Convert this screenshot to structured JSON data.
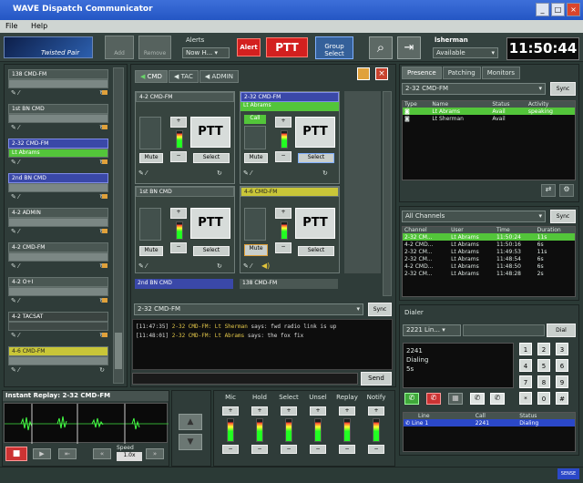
{
  "window": {
    "title": "WAVE Dispatch Communicator",
    "menu": [
      "File",
      "Help"
    ]
  },
  "toolbar": {
    "logo": "Twisted Pair",
    "add": "Add",
    "remove": "Remove",
    "alerts_label": "Alerts",
    "alerts_value": "Now H...",
    "alert": "Alert",
    "ptt": "PTT",
    "group_select": "Group Select",
    "user": "lsherman",
    "status": "Available",
    "clock": "11:50:44"
  },
  "left_channels": [
    {
      "name": "138 CMD-FM"
    },
    {
      "name": "1st BN CMD"
    },
    {
      "name": "2-32 CMD-FM",
      "talker": "Lt Abrams"
    },
    {
      "name": "2nd BN CMD"
    },
    {
      "name": "4-2 ADMIN"
    },
    {
      "name": "4-2 CMD-FM"
    },
    {
      "name": "4-2 O+I"
    },
    {
      "name": "4-2 TACSAT"
    },
    {
      "name": "4-6 CMD-FM"
    }
  ],
  "center": {
    "tabs": [
      "CMD",
      "TAC",
      "ADMIN"
    ],
    "tiles": [
      {
        "name": "4-2 CMD-FM",
        "talker": ""
      },
      {
        "name": "2-32 CMD-FM",
        "talker": "Lt Abrams",
        "tag": "Call"
      },
      {
        "name": "1st BN CMD",
        "talker": ""
      },
      {
        "name": "4-6 CMD-FM",
        "talker": ""
      }
    ],
    "ptt": "PTT",
    "mute": "Mute",
    "select": "Select",
    "plus": "+",
    "minus": "−",
    "bottom_labels": [
      "2nd BN CMD",
      "138 CMD-FM"
    ],
    "chat_channel": "2-32 CMD-FM",
    "sync": "Sync",
    "messages": [
      {
        "time": "[11:47:35]",
        "channel": "2-32 CMD-FM:",
        "user": "Lt Sherman",
        "text": "says: fwd radio link is up"
      },
      {
        "time": "[11:48:01]",
        "channel": "2-32 CMD-FM:",
        "user": "Lt Abrams",
        "text": "says: the fox fix"
      }
    ],
    "send": "Send"
  },
  "presence": {
    "tabs": [
      "Presence",
      "Patching",
      "Monitors"
    ],
    "channel": "2-32 CMD-FM",
    "sync": "Sync",
    "headers": [
      "Type",
      "Name",
      "Status",
      "Activity"
    ],
    "rows": [
      [
        "",
        "Lt Abrams",
        "Avail",
        "speaking"
      ],
      [
        "",
        "Lt Sherman",
        "Avail",
        ""
      ]
    ]
  },
  "activity": {
    "filter": "All Channels",
    "sync": "Sync",
    "headers": [
      "Channel",
      "User",
      "Time",
      "Duration"
    ],
    "rows": [
      [
        "2-32 CM...",
        "Lt Abrams",
        "11:50:24",
        "11s"
      ],
      [
        "4-2 CMD...",
        "Lt Abrams",
        "11:50:16",
        "6s"
      ],
      [
        "2-32 CM...",
        "Lt Abrams",
        "11:49:53",
        "11s"
      ],
      [
        "2-32 CM...",
        "Lt Abrams",
        "11:48:54",
        "6s"
      ],
      [
        "4-2 CMD...",
        "Lt Abrams",
        "11:48:50",
        "6s"
      ],
      [
        "2-32 CM...",
        "Lt Abrams",
        "11:48:28",
        "2s"
      ]
    ]
  },
  "dialer": {
    "label": "Dialer",
    "number": "2221 Lin...",
    "dial": "Dial",
    "display": [
      "2241",
      "Dialing",
      "5s"
    ],
    "keys": [
      "1",
      "2",
      "3",
      "4",
      "5",
      "6",
      "7",
      "8",
      "9",
      "*",
      "0",
      "#"
    ],
    "headers": [
      "Line",
      "Call",
      "Status"
    ],
    "line_row": [
      "Line 1",
      "2241",
      "Dialing"
    ]
  },
  "replay": {
    "title": "Instant Replay: 2-32 CMD-FM",
    "speed": "Speed",
    "speed_value": "1.0x"
  },
  "mixer": {
    "labels": [
      "Mic",
      "Hold",
      "Select",
      "Unsel",
      "Replay",
      "Notify"
    ]
  },
  "statusbar": {
    "right": "SENSE"
  }
}
